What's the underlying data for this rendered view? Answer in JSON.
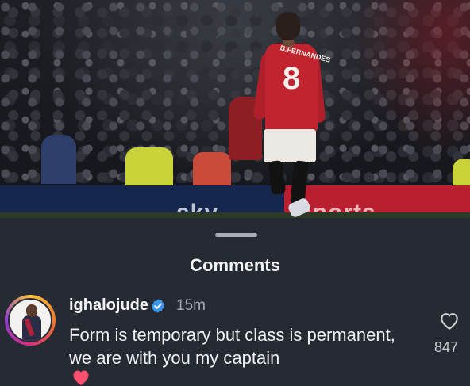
{
  "photo": {
    "shirt_number": "8",
    "shirt_name": "B.FERNANDES",
    "board_text_left": "sky",
    "board_text_right": "sports"
  },
  "sheet": {
    "title": "Comments"
  },
  "comment": {
    "username": "ighalojude",
    "verified": true,
    "time": "15m",
    "text": "Form is temporary but class is permanent, we are with you my captain",
    "emoji": "heart-emoji",
    "like_count": "847"
  },
  "icons": {
    "verified": "verified-badge-icon",
    "like": "heart-outline-icon"
  },
  "colors": {
    "background": "#262a33",
    "verified_blue": "#3897f0",
    "heart_pink": "#ff4f6e"
  }
}
